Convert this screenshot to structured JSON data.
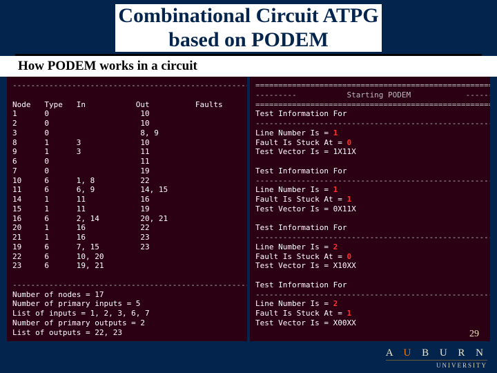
{
  "title_line1": "Combinational Circuit ATPG",
  "title_line2": "based on PODEM",
  "subtitle": "How PODEM works in a circuit",
  "page_number": "29",
  "brand": {
    "letters": "A U B U R N",
    "word": "UNIVERSITY"
  },
  "left_panel": {
    "dashes_top": "-------------------------------------------------------",
    "col_headers": "Node   Type   In           Out          Faults",
    "rows": [
      "1      0                    10",
      "2      0                    10",
      "3      0                    8, 9",
      "8      1      3             10",
      "9      1      3             11",
      "6      0                    11",
      "7      0                    19",
      "10     6      1, 8          22",
      "11     6      6, 9          14, 15",
      "14     1      11            16",
      "15     1      11            19",
      "16     6      2, 14         20, 21",
      "20     1      16            22",
      "21     1      16            23",
      "19     6      7, 15         23",
      "22     6      10, 20",
      "23     6      19, 21"
    ],
    "dashes_mid": "-------------------------------------------------------",
    "stats": [
      "Number of nodes = 17",
      "Number of primary inputs = 5",
      "List of inputs = 1, 2, 3, 6, 7",
      "Number of primary outputs = 2",
      "List of outputs = 22, 23"
    ]
  },
  "right_panel": {
    "eq_top": "=======================================================",
    "banner": "---------           Starting PODEM            ---------",
    "eq_bot": "=======================================================",
    "tests": [
      {
        "hdr": "Test Information For",
        "dash": "-------------------------------------------------------",
        "line_no": "Line Number Is = ",
        "line_val": "1",
        "stuck": "Fault Is Stuck At = ",
        "stuck_val": "0",
        "vec": "Test Vector Is = 1X11X"
      },
      {
        "hdr": "Test Information For",
        "dash": "-------------------------------------------------------",
        "line_no": "Line Number Is = ",
        "line_val": "1",
        "stuck": "Fault Is Stuck At = ",
        "stuck_val": "1",
        "vec": "Test Vector Is = 0X11X"
      },
      {
        "hdr": "Test Information For",
        "dash": "-------------------------------------------------------",
        "line_no": "Line Number Is = ",
        "line_val": "2",
        "stuck": "Fault Is Stuck At = ",
        "stuck_val": "0",
        "vec": "Test Vector Is = X10XX"
      },
      {
        "hdr": "Test Information For",
        "dash": "-------------------------------------------------------",
        "line_no": "Line Number Is = ",
        "line_val": "2",
        "stuck": "Fault Is Stuck At = ",
        "stuck_val": "1",
        "vec": "Test Vector Is = X00XX"
      }
    ]
  }
}
